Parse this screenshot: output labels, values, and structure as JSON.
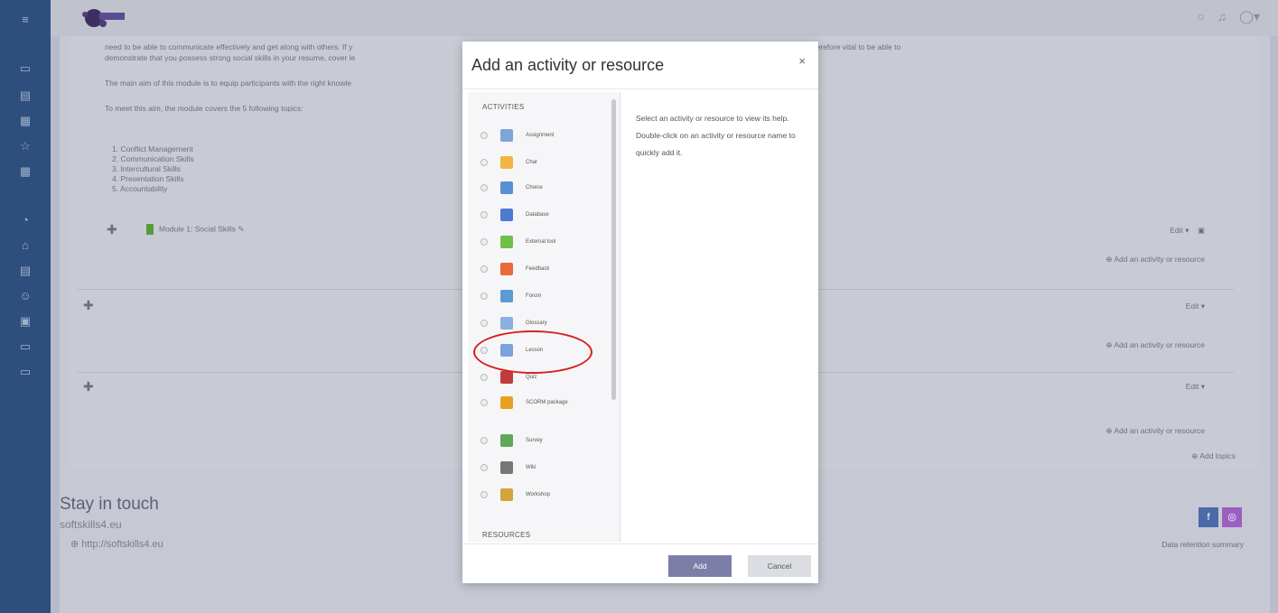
{
  "sidebar": {
    "icons": [
      "menu-icon",
      "folder-icon",
      "book-icon",
      "calendar-icon",
      "star-icon",
      "grid-icon",
      "gauge-icon",
      "home-icon",
      "list-icon",
      "users-icon",
      "cube-icon",
      "folder-icon",
      "folder-icon"
    ]
  },
  "topbar": {
    "icons": [
      "chat-icon",
      "bell-icon",
      "user-avatar-icon"
    ]
  },
  "course": {
    "para1": "need to be able to communicate effectively and get along with others. If y",
    "para1b": "reasons. It is therefore vital to be able to",
    "para2": "demonstrate that you possess strong social skills in your resume, cover le",
    "para3": "The main aim of this module is to equip participants with the right knowle",
    "para4": "To meet this aim, the module covers the 5 following topics:",
    "topics": [
      "1. Conflict Management",
      "2. Communication Skills",
      "3. Intercultural Skills",
      "4. Presentation Skills",
      "5. Accountability"
    ],
    "module_link": "Module 1: Social Skills",
    "edit_label": "Edit",
    "add_activity": "Add an activity or resource",
    "add_topics": "Add topics"
  },
  "footer": {
    "stay": "Stay in touch",
    "site": "softskills4.eu",
    "url": "http://softskills4.eu",
    "retention": "Data retention summary",
    "facebook": "f",
    "instagram": "◎"
  },
  "modal": {
    "title": "Add an activity or resource",
    "close": "×",
    "activities_label": "ACTIVITIES",
    "resources_label": "RESOURCES",
    "options": [
      {
        "label": "Assignment",
        "color": "#7fa4d8"
      },
      {
        "label": "Chat",
        "color": "#f2b544"
      },
      {
        "label": "Choice",
        "color": "#5a8fd6"
      },
      {
        "label": "Database",
        "color": "#4d7bd0"
      },
      {
        "label": "External tool",
        "color": "#6fbf4a"
      },
      {
        "label": "Feedback",
        "color": "#e86a3a"
      },
      {
        "label": "Forum",
        "color": "#5b9bd5"
      },
      {
        "label": "Glossary",
        "color": "#8ab0e0"
      },
      {
        "label": "Lesson",
        "color": "#7aa2dc"
      },
      {
        "label": "Quiz",
        "color": "#c23b3b"
      },
      {
        "label": "SCORM package",
        "color": "#e6a21f"
      },
      {
        "label": "Survey",
        "color": "#5fa85a"
      },
      {
        "label": "Wiki",
        "color": "#777777"
      },
      {
        "label": "Workshop",
        "color": "#d4a43a"
      }
    ],
    "help": "Select an activity or resource to view its help. Double-click on an activity or resource name to quickly add it.",
    "add_button": "Add",
    "cancel_button": "Cancel"
  }
}
